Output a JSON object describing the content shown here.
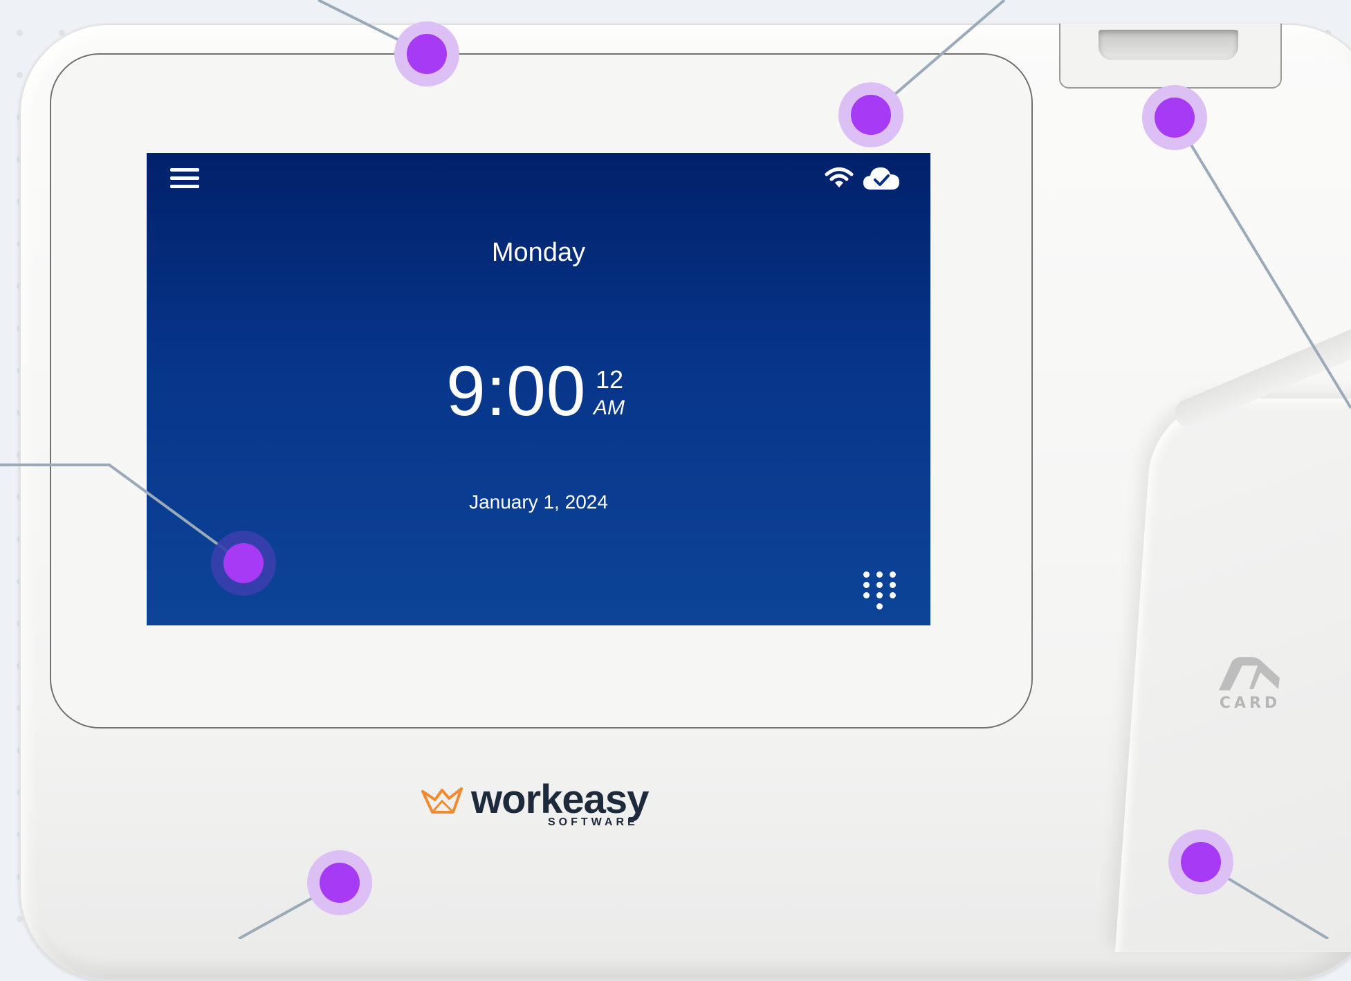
{
  "device": {
    "brand": {
      "name": "workeasy",
      "tagline": "SOFTWARE"
    },
    "card_reader_label": "CARD"
  },
  "screen": {
    "day": "Monday",
    "time": "9:00",
    "seconds": "12",
    "meridiem": "AM",
    "date": "January 1, 2024",
    "icons": {
      "menu": "hamburger-menu-icon",
      "wifi": "wifi-icon",
      "cloud": "cloud-sync-check-icon",
      "keypad": "keypad-icon"
    }
  },
  "annotations": {
    "hotspot_count": 7,
    "hotspot_color": "#a73af5",
    "hotspot_halo_color": "#dcbff5",
    "line_color": "#9aaab8"
  },
  "colors": {
    "screen_top": "#01216a",
    "screen_bottom": "#0d4498",
    "brand_orange": "#f28a2e",
    "brand_dark": "#1d2a3b"
  }
}
